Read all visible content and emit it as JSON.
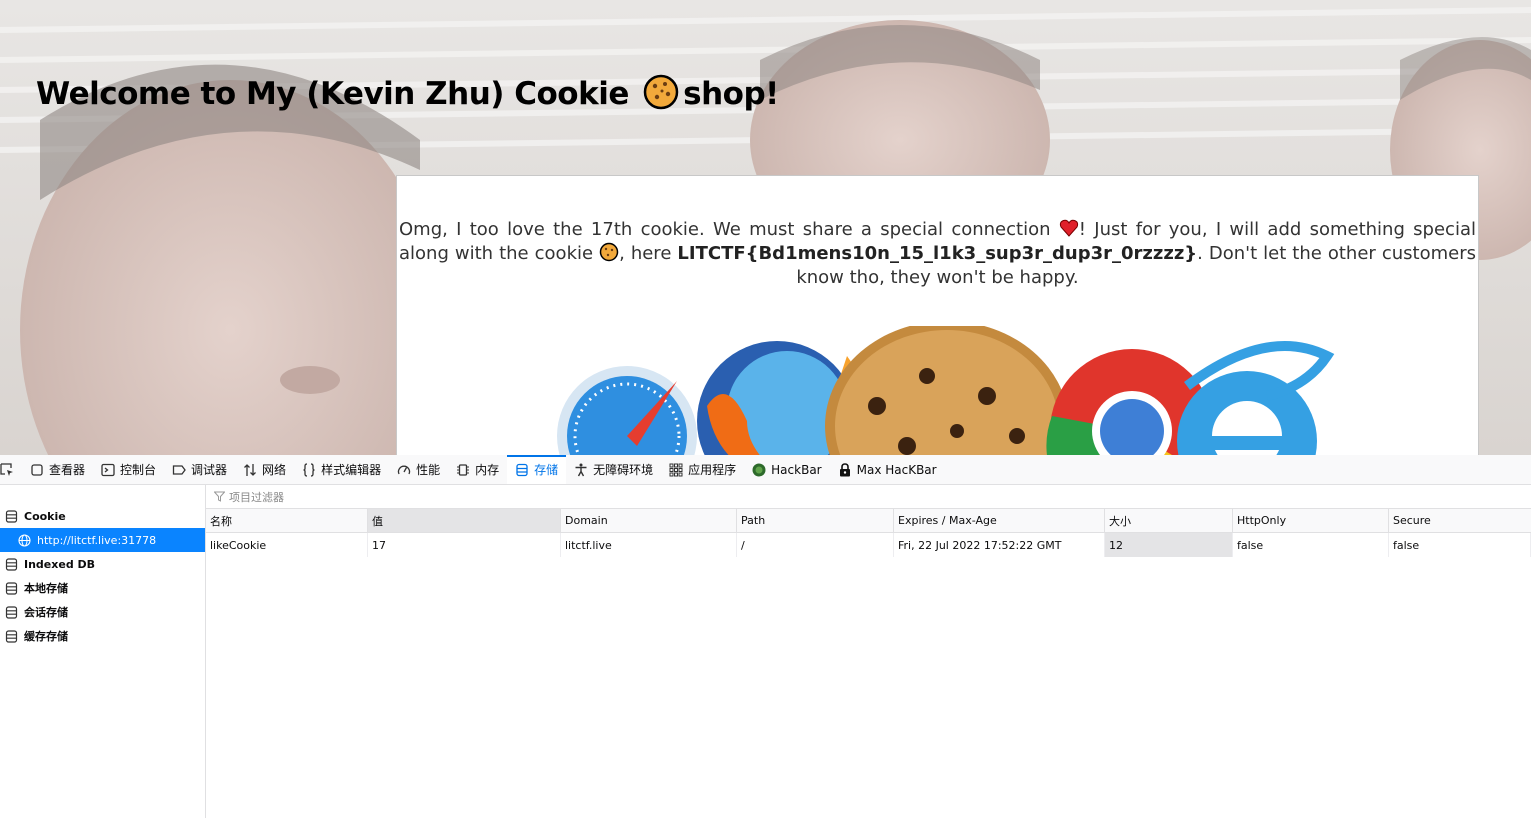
{
  "page": {
    "title_prefix": "Welcome to My (Kevin Zhu) Cookie",
    "title_suffix": "shop!",
    "message_part1": "Omg, I too love the 17th cookie. We must share a special connection",
    "message_part2": "! Just for you, I will add something special along with the cookie",
    "message_part3": ", here",
    "flag": "LITCTF{Bd1mens10n_15_l1k3_sup3r_dup3r_0rzzzz}",
    "message_part4": ". Don't let the other customers know tho, they won't be happy."
  },
  "devtools": {
    "tabs": [
      {
        "label": "查看器",
        "icon": "inspector-icon"
      },
      {
        "label": "控制台",
        "icon": "console-icon"
      },
      {
        "label": "调试器",
        "icon": "debugger-icon"
      },
      {
        "label": "网络",
        "icon": "network-icon"
      },
      {
        "label": "样式编辑器",
        "icon": "style-editor-icon"
      },
      {
        "label": "性能",
        "icon": "performance-icon"
      },
      {
        "label": "内存",
        "icon": "memory-icon"
      },
      {
        "label": "存储",
        "icon": "storage-icon",
        "active": true
      },
      {
        "label": "无障碍环境",
        "icon": "accessibility-icon"
      },
      {
        "label": "应用程序",
        "icon": "application-icon"
      },
      {
        "label": "HackBar",
        "icon": "hackbar-icon"
      },
      {
        "label": "Max HacKBar",
        "icon": "max-hackbar-icon"
      }
    ],
    "sidebar": {
      "cookie": "Cookie",
      "cookie_host": "http://litctf.live:31778",
      "indexeddb": "Indexed DB",
      "local_storage": "本地存储",
      "session_storage": "会话存储",
      "cache_storage": "缓存存储"
    },
    "filter_placeholder": "项目过滤器",
    "columns": [
      "名称",
      "值",
      "Domain",
      "Path",
      "Expires / Max-Age",
      "大小",
      "HttpOnly",
      "Secure"
    ],
    "rows": [
      [
        "likeCookie",
        "17",
        "litctf.live",
        "/",
        "Fri, 22 Jul 2022 17:52:22 GMT",
        "12",
        "false",
        "false"
      ]
    ]
  },
  "colors": {
    "accent": "#0074e8",
    "selection": "#0a84ff"
  }
}
